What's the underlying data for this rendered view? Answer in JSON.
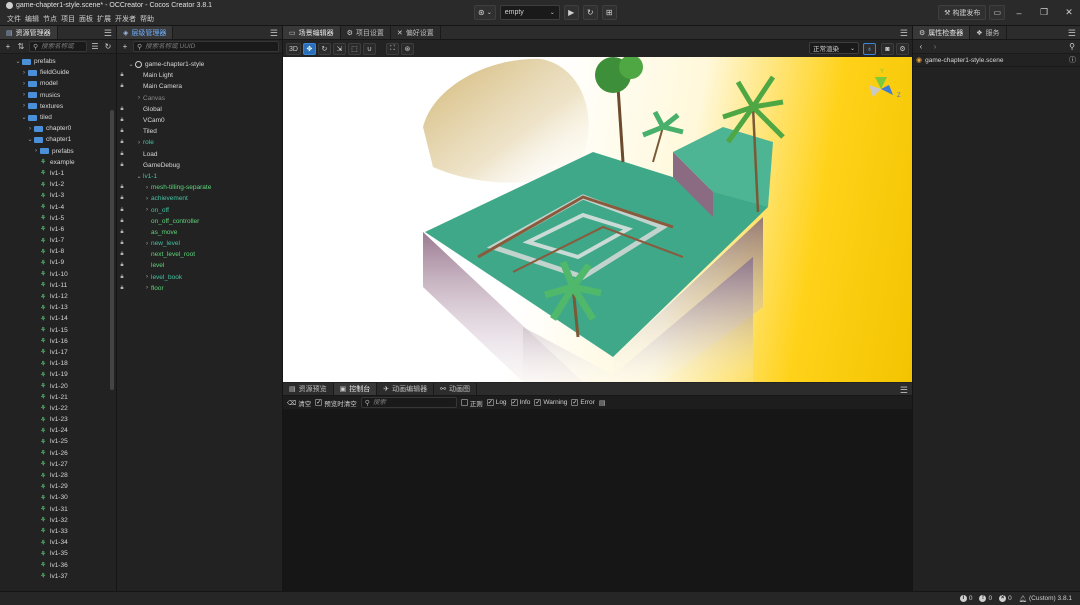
{
  "window": {
    "title": "game-chapter1-style.scene* - OCCreator - Cocos Creator 3.8.1",
    "menu": [
      "文件",
      "编辑",
      "节点",
      "项目",
      "面板",
      "扩展",
      "开发者",
      "帮助"
    ],
    "platform_select": "empty",
    "publish_label": "构建发布"
  },
  "assets": {
    "tab": "资源管理器",
    "search_placeholder": "搜索名称或",
    "tree": [
      {
        "label": "prefabs",
        "indent": 1,
        "kind": "folder",
        "arrow": "down"
      },
      {
        "label": "fieldGuide",
        "indent": 2,
        "kind": "folder",
        "arrow": "right"
      },
      {
        "label": "model",
        "indent": 2,
        "kind": "folder",
        "arrow": "right"
      },
      {
        "label": "musics",
        "indent": 2,
        "kind": "folder",
        "arrow": "right"
      },
      {
        "label": "textures",
        "indent": 2,
        "kind": "folder",
        "arrow": "right"
      },
      {
        "label": "tiled",
        "indent": 2,
        "kind": "folder",
        "arrow": "down"
      },
      {
        "label": "chapter0",
        "indent": 3,
        "kind": "folder",
        "arrow": "right"
      },
      {
        "label": "chapter1",
        "indent": 3,
        "kind": "folder",
        "arrow": "down"
      },
      {
        "label": "prefabs",
        "indent": 4,
        "kind": "folder",
        "arrow": "right"
      },
      {
        "label": "example",
        "indent": 4,
        "kind": "prefab",
        "arrow": ""
      },
      {
        "label": "lv1-1",
        "indent": 4,
        "kind": "prefab",
        "arrow": ""
      },
      {
        "label": "lv1-2",
        "indent": 4,
        "kind": "prefab",
        "arrow": ""
      },
      {
        "label": "lv1-3",
        "indent": 4,
        "kind": "prefab",
        "arrow": ""
      },
      {
        "label": "lv1-4",
        "indent": 4,
        "kind": "prefab",
        "arrow": ""
      },
      {
        "label": "lv1-5",
        "indent": 4,
        "kind": "prefab",
        "arrow": ""
      },
      {
        "label": "lv1-6",
        "indent": 4,
        "kind": "prefab",
        "arrow": ""
      },
      {
        "label": "lv1-7",
        "indent": 4,
        "kind": "prefab",
        "arrow": ""
      },
      {
        "label": "lv1-8",
        "indent": 4,
        "kind": "prefab",
        "arrow": ""
      },
      {
        "label": "lv1-9",
        "indent": 4,
        "kind": "prefab",
        "arrow": ""
      },
      {
        "label": "lv1-10",
        "indent": 4,
        "kind": "prefab",
        "arrow": ""
      },
      {
        "label": "lv1-11",
        "indent": 4,
        "kind": "prefab",
        "arrow": ""
      },
      {
        "label": "lv1-12",
        "indent": 4,
        "kind": "prefab",
        "arrow": ""
      },
      {
        "label": "lv1-13",
        "indent": 4,
        "kind": "prefab",
        "arrow": ""
      },
      {
        "label": "lv1-14",
        "indent": 4,
        "kind": "prefab",
        "arrow": ""
      },
      {
        "label": "lv1-15",
        "indent": 4,
        "kind": "prefab",
        "arrow": ""
      },
      {
        "label": "lv1-16",
        "indent": 4,
        "kind": "prefab",
        "arrow": ""
      },
      {
        "label": "lv1-17",
        "indent": 4,
        "kind": "prefab",
        "arrow": ""
      },
      {
        "label": "lv1-18",
        "indent": 4,
        "kind": "prefab",
        "arrow": ""
      },
      {
        "label": "lv1-19",
        "indent": 4,
        "kind": "prefab",
        "arrow": ""
      },
      {
        "label": "lv1-20",
        "indent": 4,
        "kind": "prefab",
        "arrow": ""
      },
      {
        "label": "lv1-21",
        "indent": 4,
        "kind": "prefab",
        "arrow": ""
      },
      {
        "label": "lv1-22",
        "indent": 4,
        "kind": "prefab",
        "arrow": ""
      },
      {
        "label": "lv1-23",
        "indent": 4,
        "kind": "prefab",
        "arrow": ""
      },
      {
        "label": "lv1-24",
        "indent": 4,
        "kind": "prefab",
        "arrow": ""
      },
      {
        "label": "lv1-25",
        "indent": 4,
        "kind": "prefab",
        "arrow": ""
      },
      {
        "label": "lv1-26",
        "indent": 4,
        "kind": "prefab",
        "arrow": ""
      },
      {
        "label": "lv1-27",
        "indent": 4,
        "kind": "prefab",
        "arrow": ""
      },
      {
        "label": "lv1-28",
        "indent": 4,
        "kind": "prefab",
        "arrow": ""
      },
      {
        "label": "lv1-29",
        "indent": 4,
        "kind": "prefab",
        "arrow": ""
      },
      {
        "label": "lv1-30",
        "indent": 4,
        "kind": "prefab",
        "arrow": ""
      },
      {
        "label": "lv1-31",
        "indent": 4,
        "kind": "prefab",
        "arrow": ""
      },
      {
        "label": "lv1-32",
        "indent": 4,
        "kind": "prefab",
        "arrow": ""
      },
      {
        "label": "lv1-33",
        "indent": 4,
        "kind": "prefab",
        "arrow": ""
      },
      {
        "label": "lv1-34",
        "indent": 4,
        "kind": "prefab",
        "arrow": ""
      },
      {
        "label": "lv1-35",
        "indent": 4,
        "kind": "prefab",
        "arrow": ""
      },
      {
        "label": "lv1-36",
        "indent": 4,
        "kind": "prefab",
        "arrow": ""
      },
      {
        "label": "lv1-37",
        "indent": 4,
        "kind": "prefab",
        "arrow": ""
      }
    ]
  },
  "hierarchy": {
    "tab": "层级管理器",
    "search_placeholder": "搜索名称或 UUID",
    "tree": [
      {
        "label": "game-chapter1-style",
        "lock": false,
        "arrow": "down",
        "style": "scene",
        "indent": 0
      },
      {
        "label": "Main Light",
        "lock": true,
        "arrow": "",
        "style": "normal",
        "indent": 1
      },
      {
        "label": "Main Camera",
        "lock": true,
        "arrow": "",
        "style": "normal",
        "indent": 1
      },
      {
        "label": "Canvas",
        "lock": false,
        "arrow": "right",
        "style": "dim",
        "indent": 1
      },
      {
        "label": "Global",
        "lock": true,
        "arrow": "",
        "style": "normal",
        "indent": 1
      },
      {
        "label": "VCam0",
        "lock": true,
        "arrow": "",
        "style": "normal",
        "indent": 1
      },
      {
        "label": "Tiled",
        "lock": true,
        "arrow": "",
        "style": "normal",
        "indent": 1
      },
      {
        "label": "role",
        "lock": true,
        "arrow": "right",
        "style": "cyan",
        "indent": 1
      },
      {
        "label": "Load",
        "lock": true,
        "arrow": "",
        "style": "normal",
        "indent": 1
      },
      {
        "label": "GameDebug",
        "lock": true,
        "arrow": "",
        "style": "normal",
        "indent": 1
      },
      {
        "label": "lv1-1",
        "lock": false,
        "arrow": "down",
        "style": "cyan",
        "indent": 1
      },
      {
        "label": "mesh-tilling-separate",
        "lock": true,
        "arrow": "right",
        "style": "green",
        "indent": 2
      },
      {
        "label": "achievement",
        "lock": true,
        "arrow": "right",
        "style": "cyan",
        "indent": 2
      },
      {
        "label": "on_off",
        "lock": true,
        "arrow": "right",
        "style": "cyan",
        "indent": 2
      },
      {
        "label": "on_off_controller",
        "lock": true,
        "arrow": "",
        "style": "green",
        "indent": 2
      },
      {
        "label": "as_move",
        "lock": true,
        "arrow": "",
        "style": "green",
        "indent": 2
      },
      {
        "label": "new_level",
        "lock": true,
        "arrow": "right",
        "style": "cyan",
        "indent": 2
      },
      {
        "label": "next_level_root",
        "lock": true,
        "arrow": "",
        "style": "green",
        "indent": 2
      },
      {
        "label": "level",
        "lock": true,
        "arrow": "",
        "style": "green",
        "indent": 2
      },
      {
        "label": "level_book",
        "lock": true,
        "arrow": "right",
        "style": "cyan",
        "indent": 2
      },
      {
        "label": "floor",
        "lock": true,
        "arrow": "right",
        "style": "green",
        "indent": 2
      }
    ]
  },
  "scene": {
    "tabs": [
      "场景编辑器",
      "项目设置",
      "偏好设置"
    ],
    "mode_3d": "3D",
    "shading_select": "正常渲染"
  },
  "console": {
    "tabs": [
      "资源预览",
      "控制台",
      "动画编辑器",
      "动画图"
    ],
    "clear_label": "清空",
    "clear_on_play": "预览时清空",
    "search_placeholder": "搜索",
    "regex_label": "正则",
    "filters": [
      "Log",
      "Info",
      "Warning",
      "Error"
    ]
  },
  "inspector": {
    "tabs": [
      "属性检查器",
      "服务"
    ],
    "selected": "game-chapter1-style.scene"
  },
  "status": {
    "info_count": "0",
    "warn_count": "0",
    "error_count": "0",
    "version": "(Custom) 3.8.1"
  },
  "colors": {
    "accent": "#2a6fb8",
    "prefab_green": "#5fd47c",
    "viewport_yellow": "#f2c400"
  }
}
